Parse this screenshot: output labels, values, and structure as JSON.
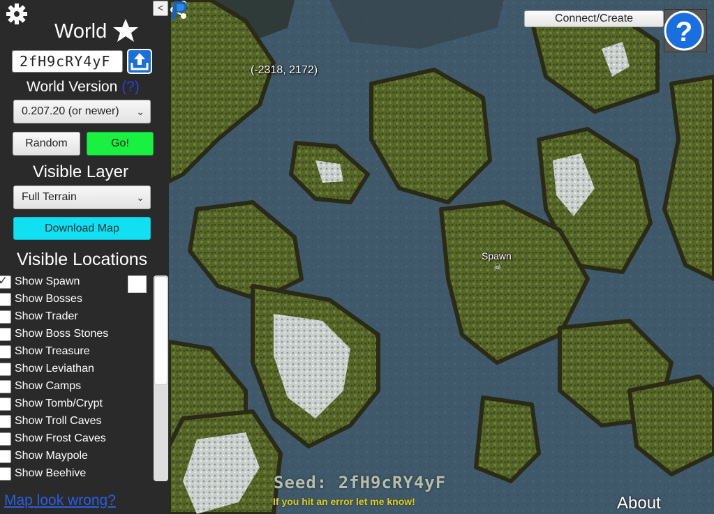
{
  "sidebar": {
    "collapse_label": "<",
    "world_title": "World",
    "seed_value": "2fH9cRY4yF",
    "version_label": "World Version",
    "version_help": "(?)",
    "version_selected": "0.207.20 (or newer)",
    "random_label": "Random",
    "go_label": "Go!",
    "layer_label": "Visible Layer",
    "layer_selected": "Full Terrain",
    "download_label": "Download Map",
    "locations_label": "Visible Locations",
    "locations": [
      {
        "label": "Show Spawn",
        "checked": true
      },
      {
        "label": "Show Bosses",
        "checked": false
      },
      {
        "label": "Show Trader",
        "checked": false
      },
      {
        "label": "Show Boss Stones",
        "checked": false
      },
      {
        "label": "Show Treasure",
        "checked": false
      },
      {
        "label": "Show Leviathan",
        "checked": false
      },
      {
        "label": "Show Camps",
        "checked": false
      },
      {
        "label": "Show Tomb/Crypt",
        "checked": false
      },
      {
        "label": "Show Troll Caves",
        "checked": false
      },
      {
        "label": "Show Frost Caves",
        "checked": false
      },
      {
        "label": "Show Maypole",
        "checked": false
      },
      {
        "label": "Show Beehive",
        "checked": false
      }
    ],
    "map_wrong_link": "Map look wrong?"
  },
  "map": {
    "coords": "(-2318, 2172)",
    "spawn_label": "Spawn",
    "spawn_marker": "☠",
    "seed_line": "Seed: 2fH9cRY4yF",
    "seed_note": "If you hit an error let me know!",
    "about_label": "About",
    "connect_label": "Connect/Create"
  },
  "colors": {
    "go_button": "#19f041",
    "download_button": "#10e0f2",
    "upload_button": "#1b6fd8",
    "link": "#2b5de0",
    "sidebar_bg": "#2a2a2a"
  },
  "icons": [
    "gear-icon",
    "star-icon",
    "upload-icon",
    "share-icon",
    "help-icon",
    "paypal-icon",
    "chevron-down-icon",
    "skull-icon"
  ]
}
